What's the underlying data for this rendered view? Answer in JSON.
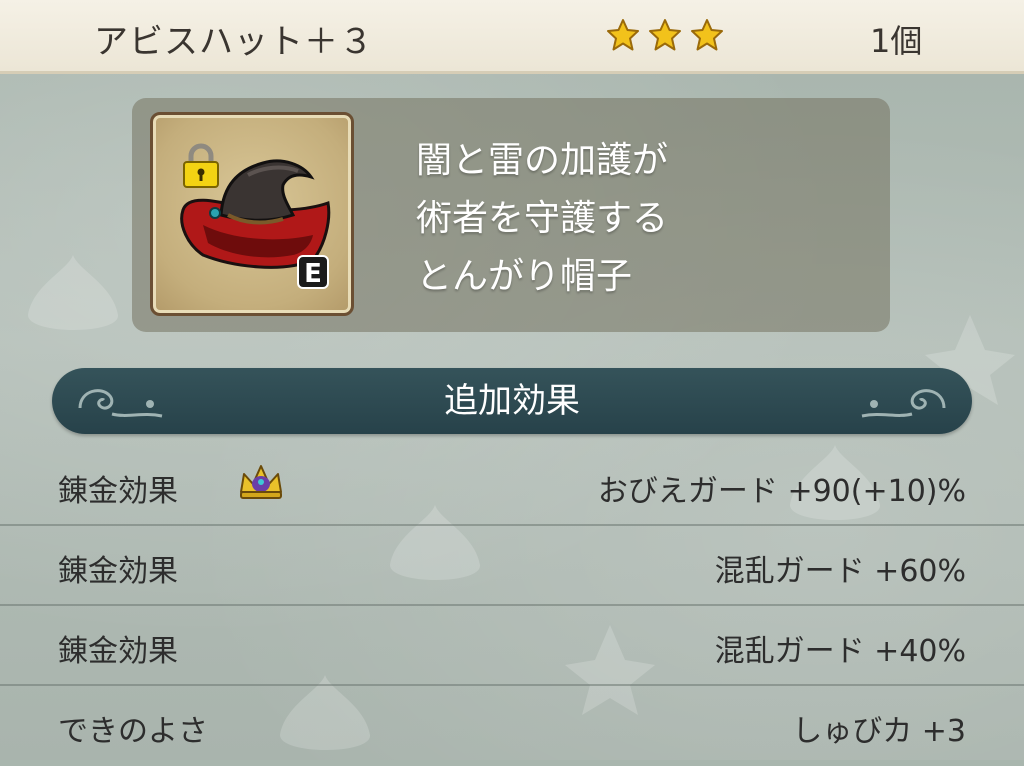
{
  "header": {
    "item_name": "アビスハット＋３",
    "star_count": 3,
    "quantity": "1個"
  },
  "item": {
    "icon": "abyss-hat-icon",
    "lock_icon": "lock-icon",
    "equipped_badge": "E",
    "description_lines": [
      "闇と雷の加護が",
      "術者を守護する",
      "とんがり帽子"
    ]
  },
  "section": {
    "title": "追加効果"
  },
  "effects": [
    {
      "label": "錬金効果",
      "value": "おびえガード +90(+10)%",
      "icon": "crown-icon"
    },
    {
      "label": "錬金効果",
      "value": "混乱ガード +60%"
    },
    {
      "label": "錬金効果",
      "value": "混乱ガード +40%"
    },
    {
      "label": "できのよさ",
      "value": "しゅびカ +3"
    }
  ],
  "colors": {
    "star": "#f2c21b",
    "banner": "#2d4950",
    "hat_brim": "#b01818"
  }
}
